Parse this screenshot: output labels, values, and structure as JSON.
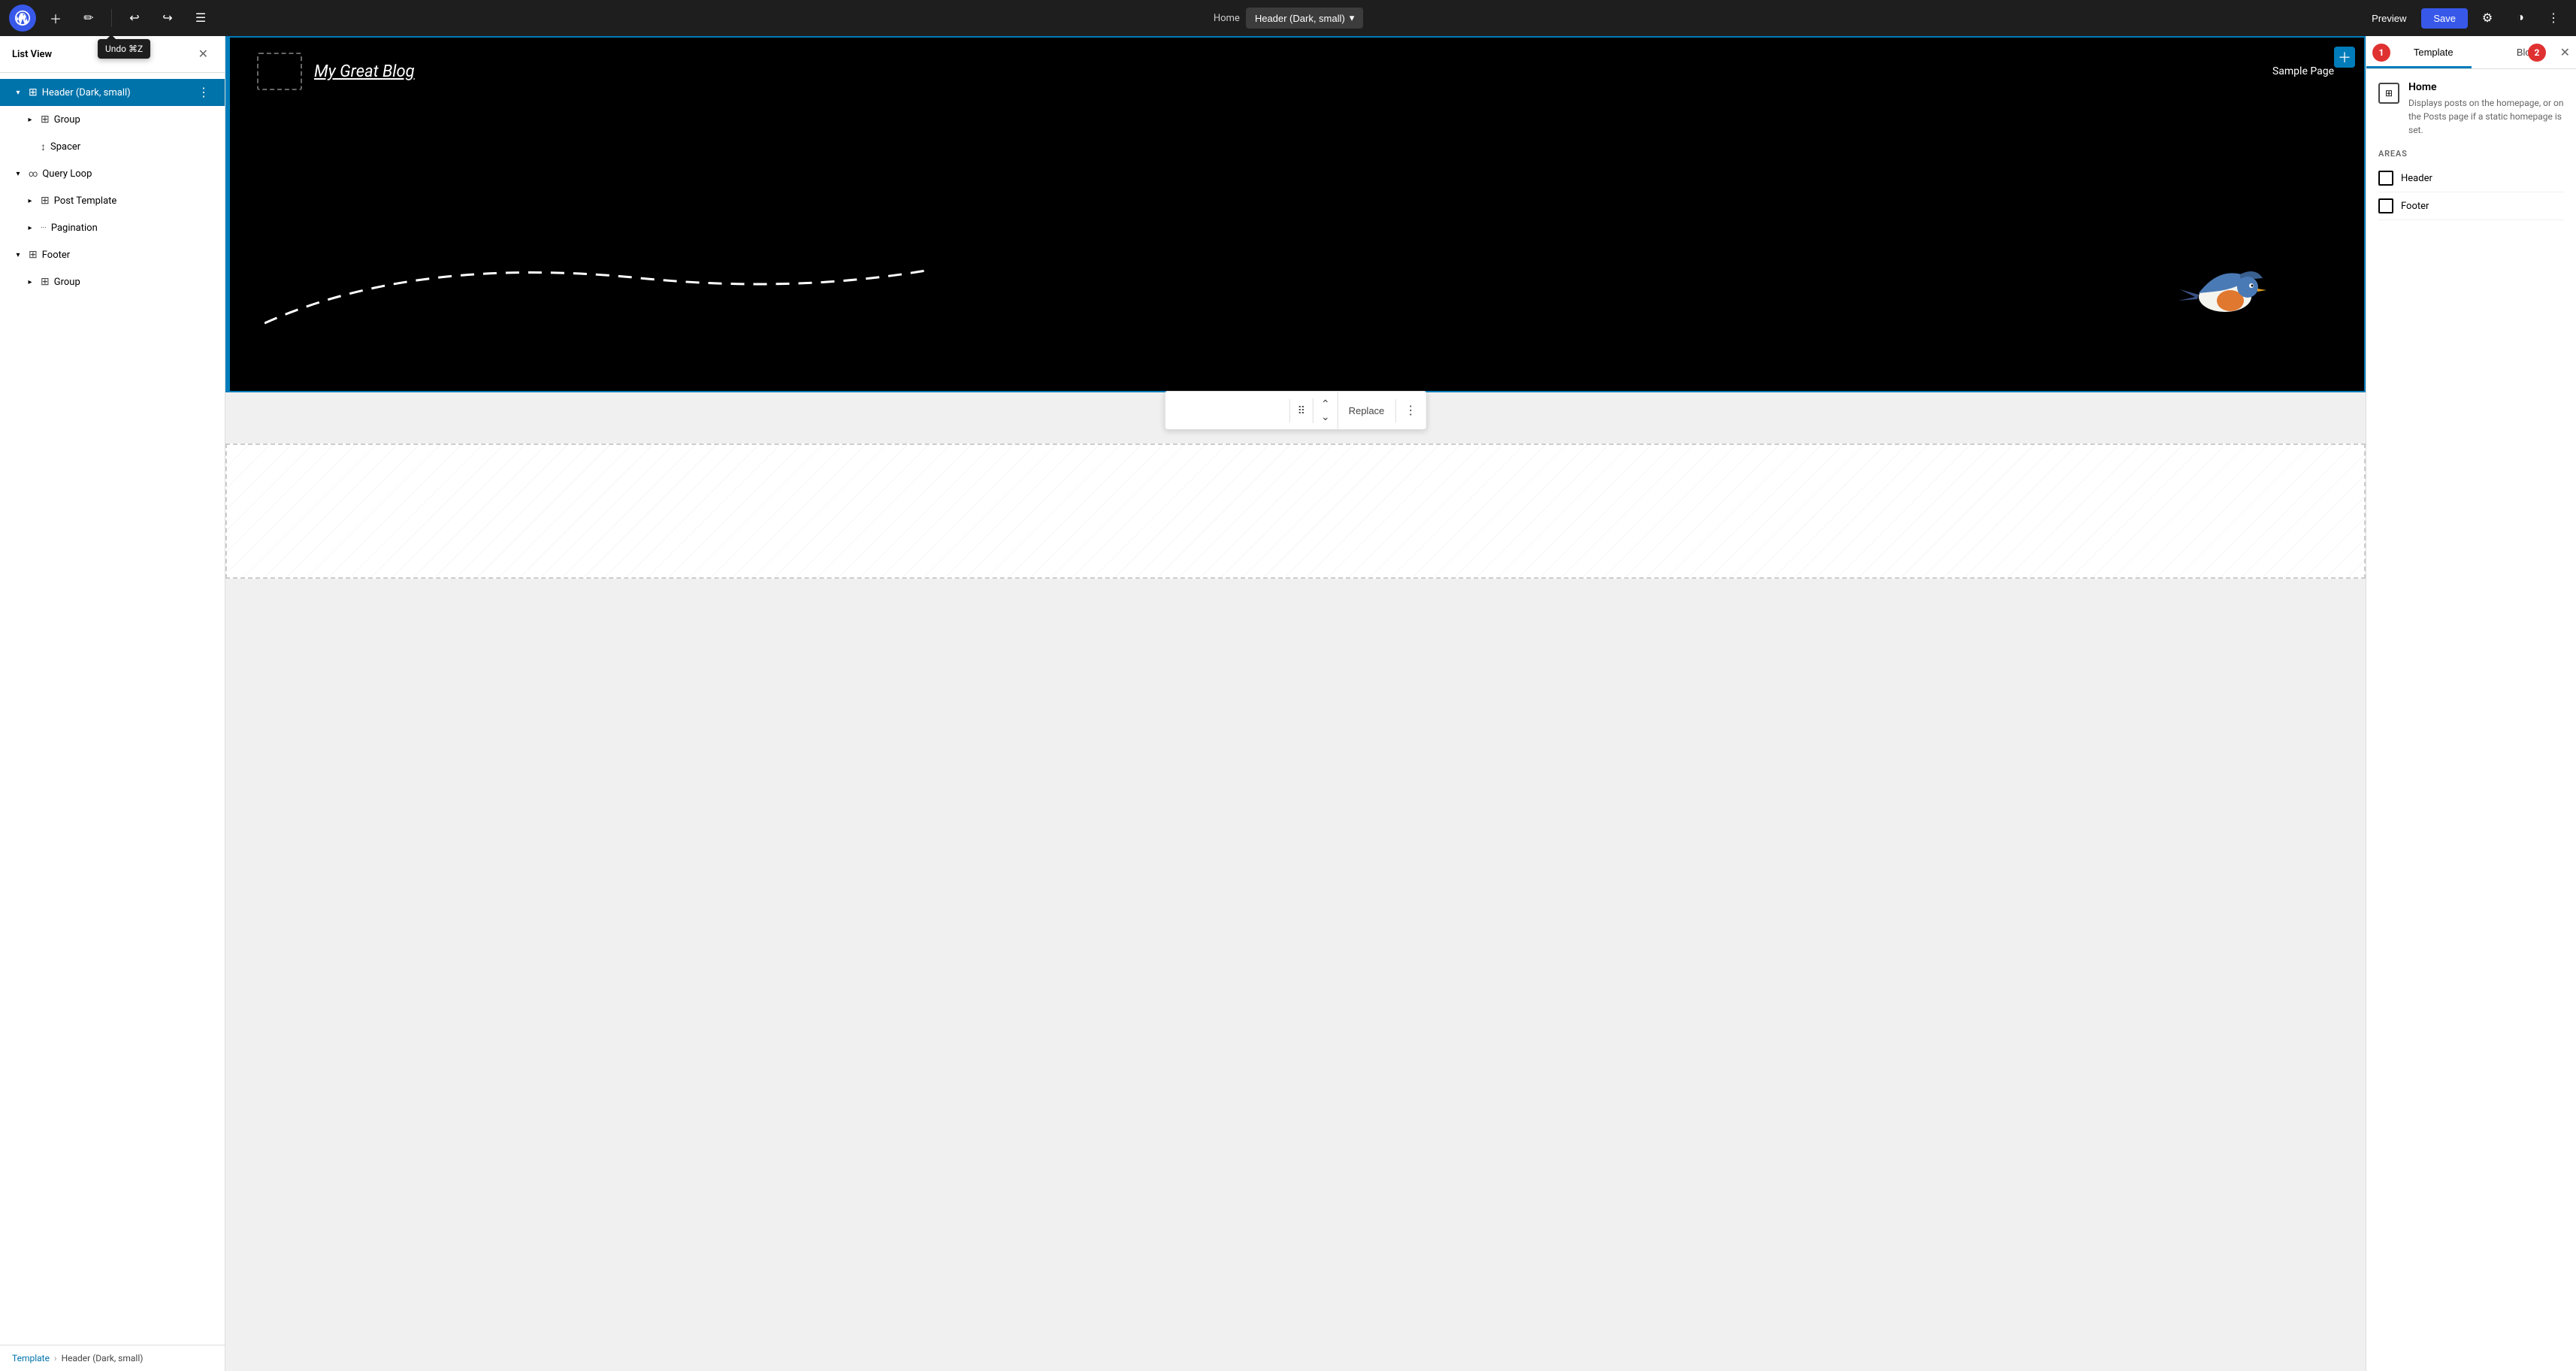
{
  "topbar": {
    "breadcrumb_home": "Home",
    "template_name": "Header (Dark, small)",
    "preview_label": "Preview",
    "save_label": "Save"
  },
  "tooltip": {
    "text": "Undo ⌘Z"
  },
  "sidebar": {
    "title": "List View",
    "items": [
      {
        "id": "header",
        "label": "Header (Dark, small)",
        "level": 0,
        "icon": "□",
        "chevron": "open",
        "selected": true
      },
      {
        "id": "group1",
        "label": "Group",
        "level": 1,
        "icon": "□",
        "chevron": "closed"
      },
      {
        "id": "spacer",
        "label": "Spacer",
        "level": 1,
        "icon": "↕",
        "chevron": "leaf"
      },
      {
        "id": "query-loop",
        "label": "Query Loop",
        "level": 0,
        "icon": "∞",
        "chevron": "open"
      },
      {
        "id": "post-template",
        "label": "Post Template",
        "level": 1,
        "icon": "□",
        "chevron": "closed"
      },
      {
        "id": "pagination",
        "label": "Pagination",
        "level": 1,
        "icon": "···",
        "chevron": "closed"
      },
      {
        "id": "footer",
        "label": "Footer",
        "level": 0,
        "icon": "□",
        "chevron": "open"
      },
      {
        "id": "group2",
        "label": "Group",
        "level": 1,
        "icon": "□",
        "chevron": "closed"
      }
    ],
    "footer_breadcrumb_template": "Template",
    "footer_breadcrumb_sep": "›",
    "footer_breadcrumb_current": "Header (Dark, small)"
  },
  "canvas": {
    "site_title": "My Great Blog",
    "nav_link": "Sample Page",
    "header_block_name": "Header (Dark, small)",
    "replace_label": "Replace"
  },
  "right_panel": {
    "tab_template": "Template",
    "tab_block": "Block",
    "badge1": "1",
    "badge2": "2",
    "template_name": "Home",
    "template_desc": "Displays posts on the homepage, or on the Posts page if a static homepage is set.",
    "areas_label": "AREAS",
    "areas": [
      {
        "name": "Header"
      },
      {
        "name": "Footer"
      }
    ]
  }
}
